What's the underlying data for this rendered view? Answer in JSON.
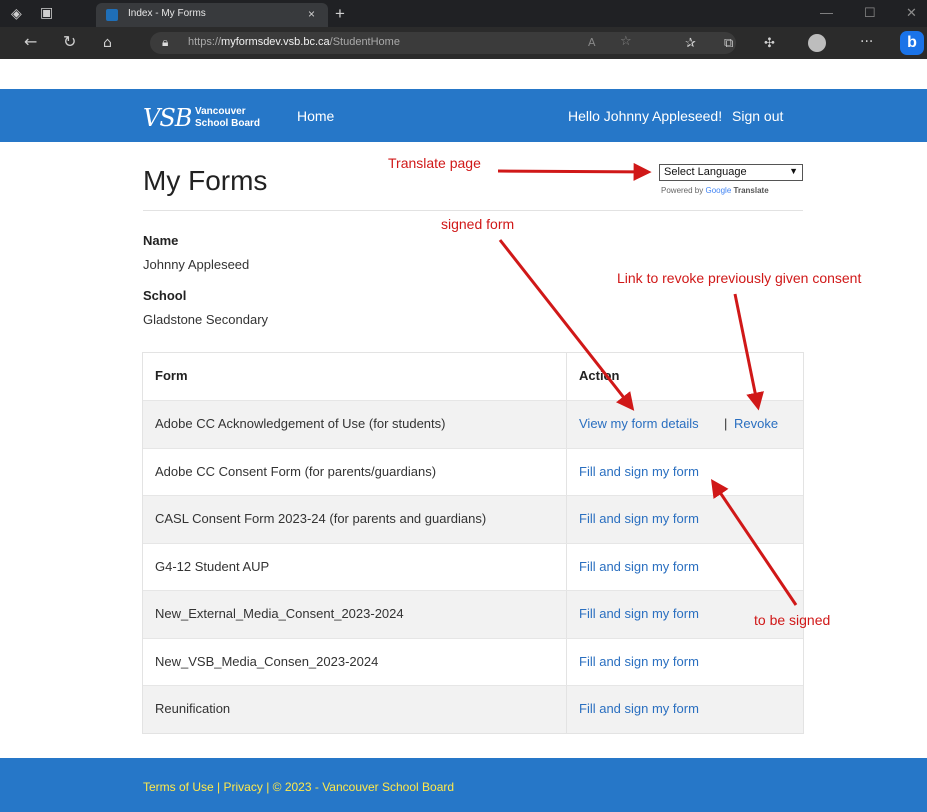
{
  "browser": {
    "tab_title": "Index - My Forms",
    "tab_close": "×",
    "new_tab": "+",
    "url_prefix": "https://",
    "url_host": "myformsdev.vsb.bc.ca",
    "url_path": "/StudentHome",
    "bing_label": "b"
  },
  "header": {
    "logo_mark": "VSB",
    "logo_line1": "Vancouver",
    "logo_line2": "School Board",
    "nav_home": "Home",
    "greeting": "Hello Johnny Appleseed!",
    "sign_out": "Sign out",
    "brand_color": "#2677c8"
  },
  "page": {
    "title": "My Forms",
    "language_select": "Select Language",
    "powered_by": "Powered by",
    "google": "Google",
    "translate": "Translate"
  },
  "profile": {
    "name_label": "Name",
    "name_value": "Johnny Appleseed",
    "school_label": "School",
    "school_value": "Gladstone Secondary"
  },
  "table": {
    "headers": {
      "form": "Form",
      "action": "Action"
    },
    "rows": [
      {
        "form": "Adobe CC Acknowledgement of Use (for students)",
        "action": "View my form details",
        "separator": "|",
        "extra": "Revoke"
      },
      {
        "form": "Adobe CC Consent Form (for parents/guardians)",
        "action": "Fill and sign my form"
      },
      {
        "form": "CASL Consent Form 2023-24 (for parents and guardians)",
        "action": "Fill and sign my form"
      },
      {
        "form": "G4-12 Student AUP",
        "action": "Fill and sign my form"
      },
      {
        "form": "New_External_Media_Consent_2023-2024",
        "action": "Fill and sign my form"
      },
      {
        "form": "New_VSB_Media_Consen_2023-2024",
        "action": "Fill and sign my form"
      },
      {
        "form": "Reunification",
        "action": "Fill and sign my form"
      }
    ]
  },
  "footer": {
    "terms": "Terms of Use",
    "sep1": "|",
    "privacy": "Privacy",
    "sep2": "|",
    "copyright": "© 2023 - Vancouver School Board"
  },
  "annotations": {
    "translate_page": "Translate page",
    "signed_form": "signed form",
    "revoke_link": "Link to revoke previously given consent",
    "to_be_signed": "to be signed",
    "color": "#d01818"
  }
}
